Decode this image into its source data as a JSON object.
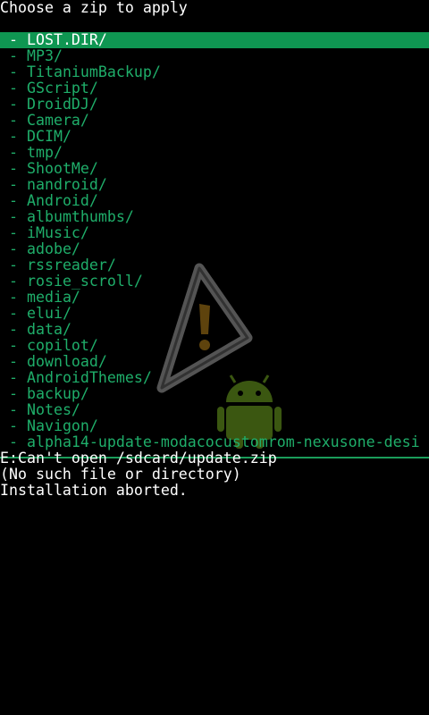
{
  "header": {
    "title": "Choose a zip to apply"
  },
  "colors": {
    "menu_text": "#1fae6a",
    "selection_bg": "#0f9652",
    "divider": "#1a9d5a",
    "log_text": "#ffffff",
    "background": "#000000"
  },
  "menu": {
    "bullet": "- ",
    "selected_index": 0,
    "items": [
      {
        "label": "LOST.DIR/"
      },
      {
        "label": "MP3/"
      },
      {
        "label": "TitaniumBackup/"
      },
      {
        "label": "GScript/"
      },
      {
        "label": "DroidDJ/"
      },
      {
        "label": "Camera/"
      },
      {
        "label": "DCIM/"
      },
      {
        "label": "tmp/"
      },
      {
        "label": "ShootMe/"
      },
      {
        "label": "nandroid/"
      },
      {
        "label": "Android/"
      },
      {
        "label": "albumthumbs/"
      },
      {
        "label": "iMusic/"
      },
      {
        "label": "adobe/"
      },
      {
        "label": "rssreader/"
      },
      {
        "label": "rosie_scroll/"
      },
      {
        "label": "media/"
      },
      {
        "label": "elui/"
      },
      {
        "label": "data/"
      },
      {
        "label": "copilot/"
      },
      {
        "label": "download/"
      },
      {
        "label": "AndroidThemes/"
      },
      {
        "label": "backup/"
      },
      {
        "label": "Notes/"
      },
      {
        "label": "Navigon/"
      },
      {
        "label": "alpha14-update-modacocustomrom-nexusone-desi"
      }
    ]
  },
  "log": {
    "lines": [
      "E:Can't open /sdcard/update.zip",
      "(No such file or directory)",
      "Installation aborted."
    ]
  },
  "background_art": {
    "icons": [
      "warning-triangle-icon",
      "android-robot-icon"
    ]
  }
}
